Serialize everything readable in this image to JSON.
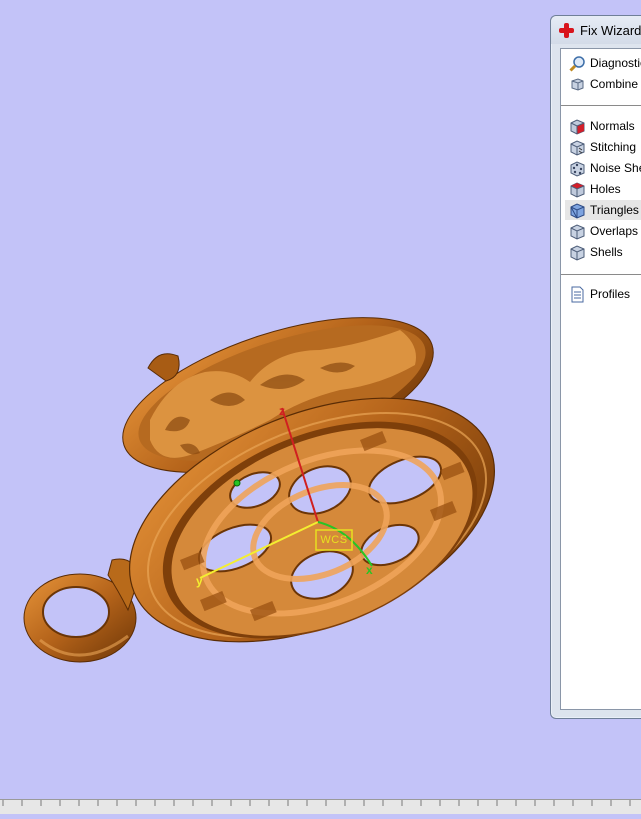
{
  "viewport": {
    "wcs_label": "WCS",
    "axes": {
      "x": "x",
      "y": "y",
      "z": "z"
    },
    "colors": {
      "background": "#c3c3f8",
      "model": "#c7761d",
      "axis_x": "#27c425",
      "axis_y": "#f4ee30",
      "axis_z": "#d02020"
    }
  },
  "fix_wizard": {
    "title": "Fix Wizard (",
    "title_icon": "red-cross-icon",
    "top_items": [
      {
        "label": "Diagnostics",
        "icon": "magnifier-icon"
      },
      {
        "label": "Combine",
        "icon": "combine-cubes-icon"
      }
    ],
    "check_items": [
      {
        "label": "Normals",
        "icon": "cube-red-face-icon"
      },
      {
        "label": "Stitching",
        "icon": "cube-stitch-icon"
      },
      {
        "label": "Noise Shells",
        "icon": "cube-dots-icon"
      },
      {
        "label": "Holes",
        "icon": "cube-red-face-icon"
      },
      {
        "label": "Triangles",
        "icon": "cube-blue-icon",
        "selected": true
      },
      {
        "label": "Overlaps",
        "icon": "cube-gray-icon"
      },
      {
        "label": "Shells",
        "icon": "cube-gray-icon"
      }
    ],
    "bottom_items": [
      {
        "label": "Profiles",
        "icon": "document-icon"
      }
    ]
  }
}
